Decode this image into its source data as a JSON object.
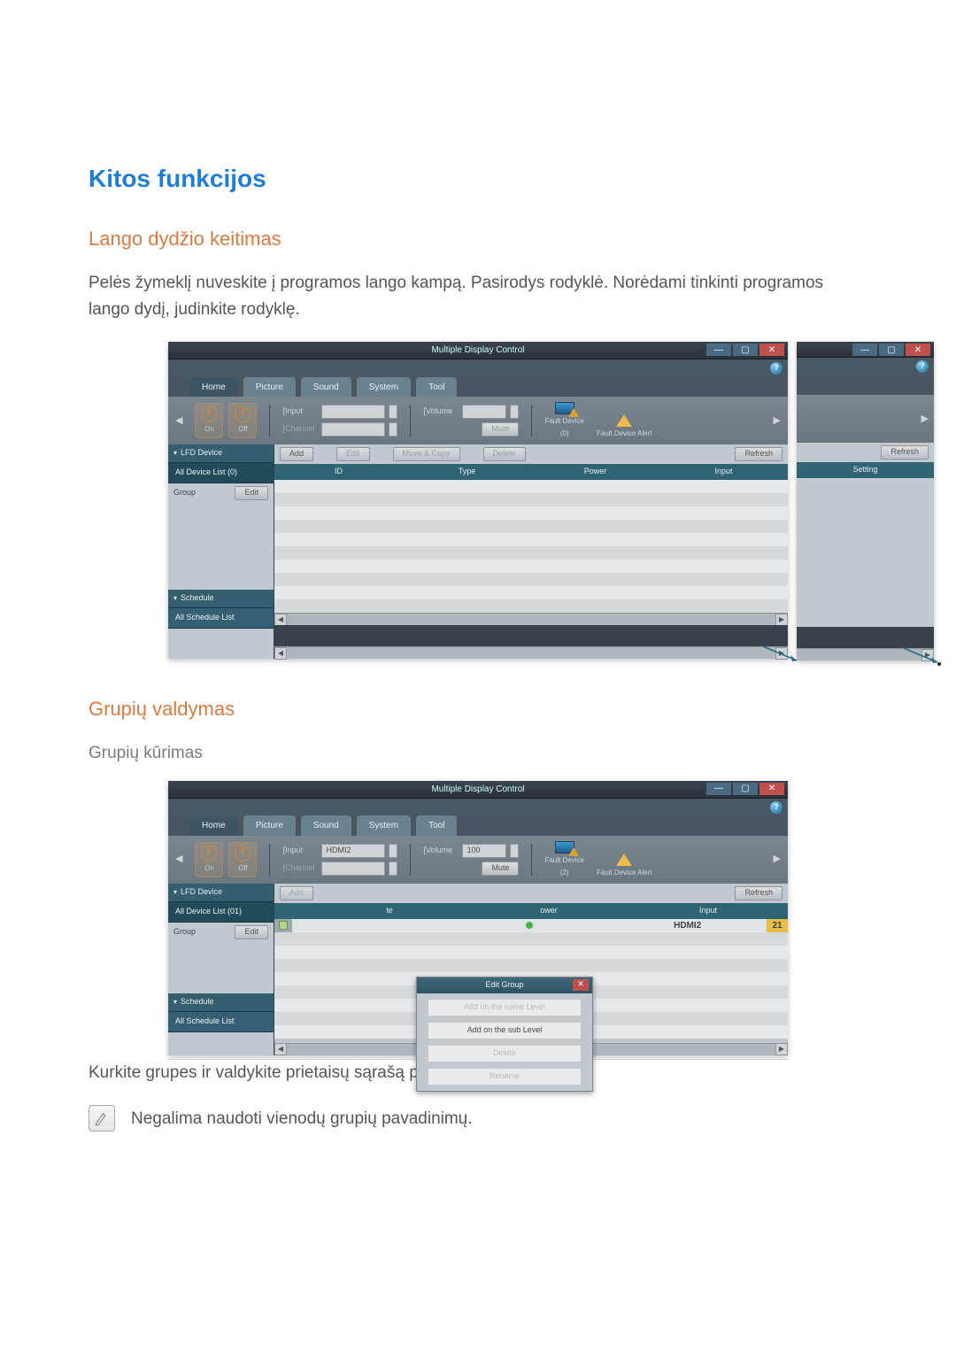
{
  "page": {
    "main_heading": "Kitos funkcijos",
    "section1_heading": "Lango dydžio keitimas",
    "section1_body": "Pelės žymeklį nuveskite į programos lango kampą. Pasirodys rodyklė. Norėdami tinkinti programos lango dydį, judinkite rodyklę.",
    "section2_heading": "Grupių valdymas",
    "section2_sub": "Grupių kūrimas",
    "section2_body": "Kurkite grupes ir valdykite prietaisų sąrašą pagal grupę.",
    "note": "Negalima naudoti vienodų grupių pavadinimų."
  },
  "app1": {
    "title": "Multiple Display Control",
    "tabs": [
      "Home",
      "Picture",
      "Sound",
      "System",
      "Tool"
    ],
    "toolbar": {
      "input_label": "[Input",
      "channel_label": "[Channel",
      "input_value": "",
      "volume_label": "[Volume",
      "volume_value": "",
      "mute": "Mute"
    },
    "power": {
      "on": "On",
      "off": "Off"
    },
    "faults": {
      "device": "Fault Device",
      "count0": "(0)",
      "alert": "Fault Device Alert"
    },
    "sidebar": {
      "lfd": "LFD Device",
      "all_device": "All Device List (0)",
      "group": "Group",
      "edit": "Edit",
      "schedule": "Schedule",
      "all_schedule": "All Schedule List"
    },
    "actions": {
      "add": "Add",
      "edit": "Edit",
      "move": "Move & Copy",
      "delete": "Delete",
      "refresh": "Refresh"
    },
    "columns": [
      "ID",
      "Type",
      "Power",
      "Input"
    ],
    "aux": {
      "refresh": "Refresh",
      "setting": "Setting"
    }
  },
  "app2": {
    "title": "Multiple Display Control",
    "tabs": [
      "Home",
      "Picture",
      "Sound",
      "System",
      "Tool"
    ],
    "toolbar": {
      "input_label": "[Input",
      "channel_label": "[Channel",
      "input_value": "HDMI2",
      "volume_label": "[Volume",
      "volume_value": "100",
      "mute": "Mute"
    },
    "power": {
      "on": "On",
      "off": "Off"
    },
    "faults": {
      "device": "Fault Device",
      "count2": "(2)",
      "alert": "Fault Device Alert"
    },
    "sidebar": {
      "lfd": "LFD Device",
      "all_device": "All Device List (01)",
      "group": "Group",
      "edit": "Edit",
      "schedule": "Schedule",
      "all_schedule": "All Schedule List"
    },
    "actions": {
      "add": "Add",
      "refresh": "Refresh"
    },
    "columns_partial": {
      "te": "te",
      "power": "ower",
      "input": "Input"
    },
    "row1": {
      "input": "HDMI2",
      "num": "21"
    },
    "dialog": {
      "title": "Edit Group",
      "same": "Add on the same Level",
      "sub": "Add on the sub Level",
      "delete": "Delete",
      "rename": "Rename"
    }
  }
}
